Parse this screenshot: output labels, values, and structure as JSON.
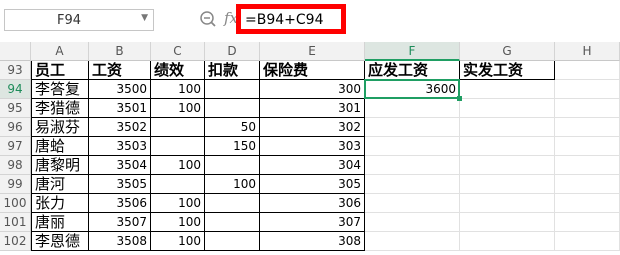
{
  "formula_bar": {
    "name_box": "F94",
    "formula": "=B94+C94",
    "fx_label": "fx"
  },
  "columns": [
    "A",
    "B",
    "C",
    "D",
    "E",
    "F",
    "G",
    "H"
  ],
  "selected": {
    "col": "F",
    "row": "94"
  },
  "header_row": {
    "row_num": "93",
    "cells": [
      "员工",
      "工资",
      "绩效",
      "扣款",
      "保险费",
      "应发工资",
      "实发工资"
    ]
  },
  "rows": [
    {
      "row_num": "94",
      "name": "李答复",
      "salary": "3500",
      "bonus": "100",
      "deduct": "",
      "insurance": "300",
      "gross": "3600"
    },
    {
      "row_num": "95",
      "name": "李猎德",
      "salary": "3501",
      "bonus": "100",
      "deduct": "",
      "insurance": "301",
      "gross": ""
    },
    {
      "row_num": "96",
      "name": "易淑芬",
      "salary": "3502",
      "bonus": "",
      "deduct": "50",
      "insurance": "302",
      "gross": ""
    },
    {
      "row_num": "97",
      "name": "唐蛤",
      "salary": "3503",
      "bonus": "",
      "deduct": "150",
      "insurance": "303",
      "gross": ""
    },
    {
      "row_num": "98",
      "name": "唐黎明",
      "salary": "3504",
      "bonus": "100",
      "deduct": "",
      "insurance": "304",
      "gross": ""
    },
    {
      "row_num": "99",
      "name": "唐河",
      "salary": "3505",
      "bonus": "",
      "deduct": "100",
      "insurance": "305",
      "gross": ""
    },
    {
      "row_num": "100",
      "name": "张力",
      "salary": "3506",
      "bonus": "100",
      "deduct": "",
      "insurance": "306",
      "gross": ""
    },
    {
      "row_num": "101",
      "name": "唐丽",
      "salary": "3507",
      "bonus": "100",
      "deduct": "",
      "insurance": "307",
      "gross": ""
    },
    {
      "row_num": "102",
      "name": "李恩德",
      "salary": "3508",
      "bonus": "100",
      "deduct": "",
      "insurance": "308",
      "gross": ""
    }
  ],
  "colors": {
    "accent": "#1f9e63",
    "highlight_border": "#ff0000"
  }
}
